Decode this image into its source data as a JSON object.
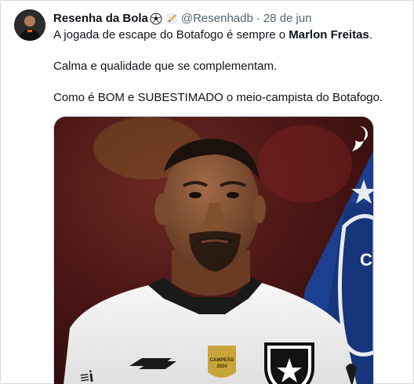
{
  "tweet": {
    "author_name": "Resenha da Bola",
    "handle": "@Resenhadb",
    "separator": "·",
    "date": "28 de jun",
    "line1_prefix": "A jogada de escape do Botafogo é sempre o ",
    "line1_bold": "Marlon Freitas",
    "line1_suffix": ".",
    "line2": "Calma e qualidade que se complementam.",
    "line3": "Como é BOM e SUBESTIMADO o meio-campista do Botafogo.",
    "badges": [
      "soccer-ball-icon",
      "pencil-icon"
    ]
  },
  "media": {
    "patch_line1": "CAMPEÃO",
    "patch_line2": "2024",
    "colors": {
      "background_red": "#5a1a1a",
      "flag_blue": "#1d3f8f",
      "jersey": "#f2f2f2"
    }
  }
}
